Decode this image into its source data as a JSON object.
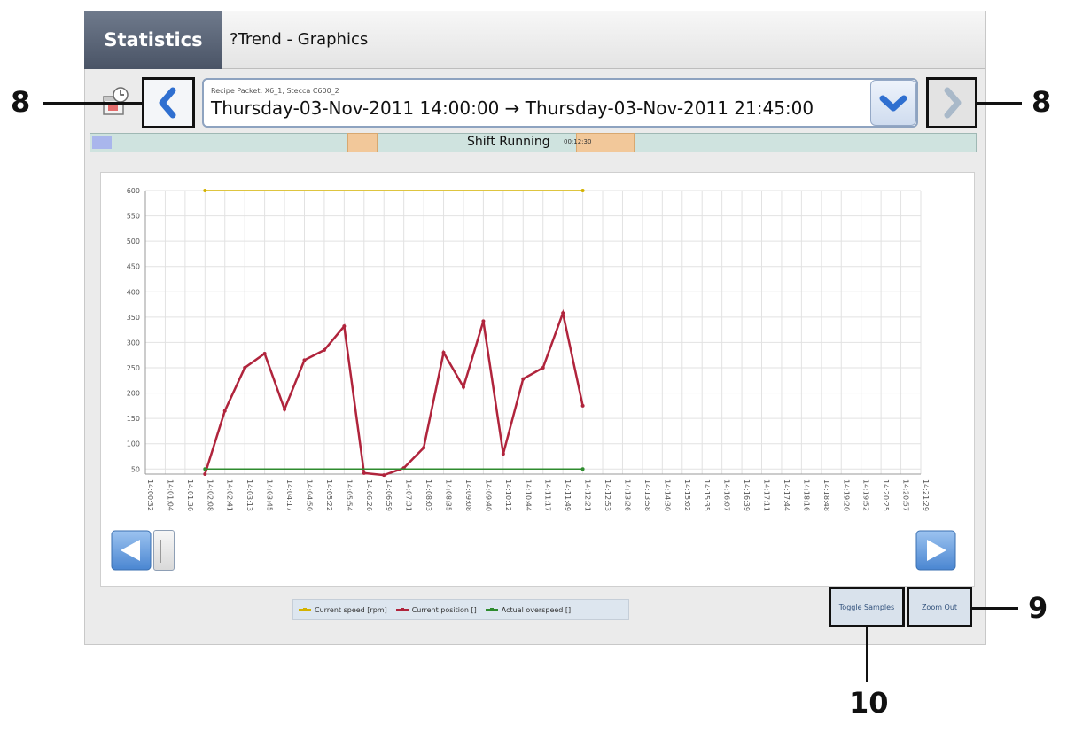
{
  "tabs": {
    "statistics_label": "Statistics",
    "title": "?Trend - Graphics"
  },
  "header": {
    "recipe_line": "Recipe   Packet: X6_1, Stecca  C600_2",
    "date_range": "Thursday-03-Nov-2011 14:00:00 → Thursday-03-Nov-2011 21:45:00"
  },
  "shift": {
    "label": "Shift Running",
    "time": "00:12:30"
  },
  "legend": {
    "items": [
      {
        "label": "Current speed [rpm]",
        "color": "#d4b200"
      },
      {
        "label": "Current position []",
        "color": "#b0243c"
      },
      {
        "label": "Actual overspeed []",
        "color": "#2e8b2e"
      }
    ]
  },
  "buttons": {
    "toggle_samples": "Toggle Samples",
    "zoom_out": "Zoom Out"
  },
  "callouts": {
    "prev": "8",
    "next": "8",
    "zoom": "9",
    "toggle": "10"
  },
  "icons": [
    "calendar-clock-icon",
    "chevron-left-icon",
    "chevron-down-icon",
    "chevron-right-icon",
    "arrow-left-icon",
    "arrow-right-icon"
  ],
  "chart_data": {
    "type": "line",
    "x": [
      "14:00:32",
      "14:01:04",
      "14:01:36",
      "14:02:08",
      "14:02:41",
      "14:03:13",
      "14:03:45",
      "14:04:17",
      "14:04:50",
      "14:05:22",
      "14:05:54",
      "14:06:26",
      "14:06:59",
      "14:07:31",
      "14:08:03",
      "14:08:35",
      "14:09:08",
      "14:09:40",
      "14:10:12",
      "14:10:44",
      "14:11:17",
      "14:11:49",
      "14:12:21",
      "14:12:53",
      "14:13:26",
      "14:13:58",
      "14:14:30",
      "14:15:02",
      "14:15:35",
      "14:16:07",
      "14:16:39",
      "14:17:11",
      "14:17:44",
      "14:18:16",
      "14:18:48",
      "14:19:20",
      "14:19:52",
      "14:20:25",
      "14:20:57",
      "14:21:29"
    ],
    "ylim": [
      40,
      600
    ],
    "yticks": [
      50,
      100,
      150,
      200,
      250,
      300,
      350,
      400,
      450,
      500,
      550,
      600
    ],
    "grid": true,
    "series": [
      {
        "name": "Current speed [rpm]",
        "color": "#d4b200",
        "x_index": [
          3,
          22
        ],
        "values": [
          600,
          600
        ]
      },
      {
        "name": "Current position []",
        "color": "#b0243c",
        "x_index": [
          3,
          4,
          5,
          6,
          7,
          8,
          9,
          10,
          11,
          12,
          13,
          14,
          15,
          16,
          17,
          18,
          19,
          20,
          21,
          22
        ],
        "values": [
          40,
          165,
          250,
          278,
          168,
          265,
          285,
          332,
          42,
          38,
          52,
          92,
          280,
          212,
          342,
          80,
          228,
          250,
          358,
          175
        ]
      },
      {
        "name": "Actual overspeed []",
        "color": "#2e8b2e",
        "x_index": [
          3,
          22
        ],
        "values": [
          50,
          50
        ]
      }
    ]
  }
}
